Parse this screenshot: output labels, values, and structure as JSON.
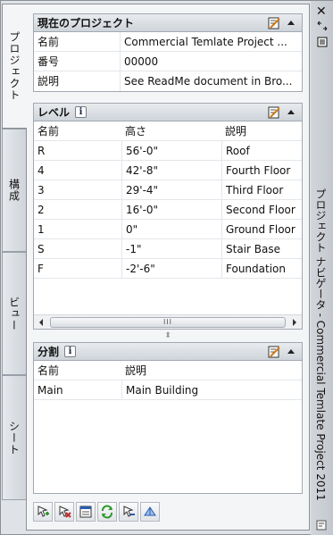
{
  "tabs": [
    {
      "label": "プロジェクト",
      "active": true
    },
    {
      "label": "構成",
      "active": false
    },
    {
      "label": "ビュー",
      "active": false
    },
    {
      "label": "シート",
      "active": false
    }
  ],
  "current_project": {
    "title": "現在のプロジェクト",
    "rows": [
      {
        "key": "名前",
        "value": "Commercial Temlate Project  ..."
      },
      {
        "key": "番号",
        "value": "00000"
      },
      {
        "key": "説明",
        "value": "See ReadMe document in Bro..."
      }
    ]
  },
  "levels": {
    "title": "レベル",
    "info_glyph": "i",
    "columns": [
      "名前",
      "高さ",
      "説明"
    ],
    "rows": [
      [
        "R",
        "56'-0\"",
        "Roof"
      ],
      [
        "4",
        "42'-8\"",
        "Fourth Floor"
      ],
      [
        "3",
        "29'-4\"",
        "Third Floor"
      ],
      [
        "2",
        "16'-0\"",
        "Second Floor"
      ],
      [
        "1",
        "0\"",
        "Ground Floor"
      ],
      [
        "S",
        "-1\"",
        "Stair Base"
      ],
      [
        "F",
        "-2'-6\"",
        "Foundation"
      ]
    ],
    "scroll_grip": "III"
  },
  "divisions": {
    "title": "分割",
    "info_glyph": "i",
    "columns": [
      "名前",
      "説明"
    ],
    "rows": [
      [
        "Main",
        "Main Building"
      ]
    ]
  },
  "side_title": "プロジェクト ナビゲータ - Commercial Temlate Project  2011",
  "close_glyph": "✕",
  "colors": {
    "accent_green": "#2e9a2e",
    "accent_red": "#c42a2a",
    "accent_blue": "#2a5db0"
  }
}
